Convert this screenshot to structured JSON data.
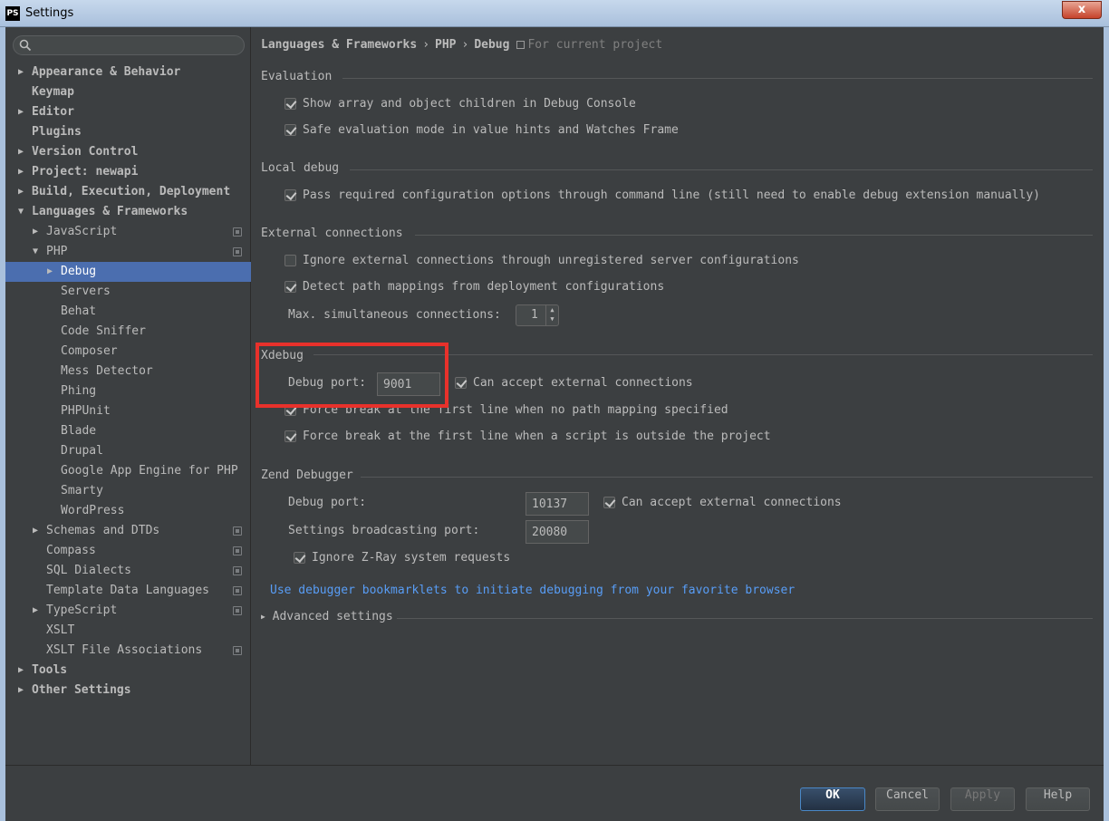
{
  "window": {
    "title": "Settings",
    "app_icon": "PS",
    "close_label": "x"
  },
  "search": {
    "placeholder": "",
    "value": ""
  },
  "sidebar": {
    "items": [
      {
        "label": "Appearance & Behavior",
        "level": 0,
        "arrow": "▶",
        "bold": true
      },
      {
        "label": "Keymap",
        "level": 0,
        "arrow": "",
        "bold": true
      },
      {
        "label": "Editor",
        "level": 0,
        "arrow": "▶",
        "bold": true
      },
      {
        "label": "Plugins",
        "level": 0,
        "arrow": "",
        "bold": true
      },
      {
        "label": "Version Control",
        "level": 0,
        "arrow": "▶",
        "bold": true
      },
      {
        "label": "Project: newapi",
        "level": 0,
        "arrow": "▶",
        "bold": true
      },
      {
        "label": "Build, Execution, Deployment",
        "level": 0,
        "arrow": "▶",
        "bold": true
      },
      {
        "label": "Languages & Frameworks",
        "level": 0,
        "arrow": "▼",
        "bold": true
      },
      {
        "label": "JavaScript",
        "level": 1,
        "arrow": "▶",
        "project": true
      },
      {
        "label": "PHP",
        "level": 1,
        "arrow": "▼",
        "project": true
      },
      {
        "label": "Debug",
        "level": 2,
        "arrow": "▶",
        "selected": true
      },
      {
        "label": "Servers",
        "level": 2,
        "arrow": ""
      },
      {
        "label": "Behat",
        "level": 2,
        "arrow": ""
      },
      {
        "label": "Code Sniffer",
        "level": 2,
        "arrow": ""
      },
      {
        "label": "Composer",
        "level": 2,
        "arrow": ""
      },
      {
        "label": "Mess Detector",
        "level": 2,
        "arrow": ""
      },
      {
        "label": "Phing",
        "level": 2,
        "arrow": ""
      },
      {
        "label": "PHPUnit",
        "level": 2,
        "arrow": ""
      },
      {
        "label": "Blade",
        "level": 2,
        "arrow": ""
      },
      {
        "label": "Drupal",
        "level": 2,
        "arrow": ""
      },
      {
        "label": "Google App Engine for PHP",
        "level": 2,
        "arrow": ""
      },
      {
        "label": "Smarty",
        "level": 2,
        "arrow": ""
      },
      {
        "label": "WordPress",
        "level": 2,
        "arrow": ""
      },
      {
        "label": "Schemas and DTDs",
        "level": 1,
        "arrow": "▶",
        "project": true
      },
      {
        "label": "Compass",
        "level": 1,
        "arrow": "",
        "project": true
      },
      {
        "label": "SQL Dialects",
        "level": 1,
        "arrow": "",
        "project": true
      },
      {
        "label": "Template Data Languages",
        "level": 1,
        "arrow": "",
        "project": true
      },
      {
        "label": "TypeScript",
        "level": 1,
        "arrow": "▶",
        "project": true
      },
      {
        "label": "XSLT",
        "level": 1,
        "arrow": ""
      },
      {
        "label": "XSLT File Associations",
        "level": 1,
        "arrow": "",
        "project": true
      },
      {
        "label": "Tools",
        "level": 0,
        "arrow": "▶",
        "bold": true
      },
      {
        "label": "Other Settings",
        "level": 0,
        "arrow": "▶",
        "bold": true
      }
    ]
  },
  "breadcrumb": {
    "part1": "Languages & Frameworks",
    "part2": "PHP",
    "part3": "Debug",
    "sep": "›",
    "scope": "For current project"
  },
  "evaluation": {
    "title": "Evaluation",
    "show_array": {
      "label": "Show array and object children in Debug Console",
      "checked": true
    },
    "safe_eval": {
      "label": "Safe evaluation mode in value hints and Watches Frame",
      "checked": true
    }
  },
  "local_debug": {
    "title": "Local debug",
    "pass_config": {
      "label": "Pass required configuration options through command line (still need to enable debug extension manually)",
      "checked": true
    }
  },
  "external": {
    "title": "External connections",
    "ignore_unregistered": {
      "label": "Ignore external connections through unregistered server configurations",
      "checked": false
    },
    "detect_mappings": {
      "label": "Detect path mappings from deployment configurations",
      "checked": true
    },
    "max_conn_label": "Max. simultaneous connections:",
    "max_conn_value": "1"
  },
  "xdebug": {
    "title": "Xdebug",
    "port_label": "Debug port:",
    "port_value": "9001",
    "accept_external": {
      "label": "Can accept external connections",
      "checked": true
    },
    "force_break_first": {
      "label": "Force break at the first line when no path mapping specified",
      "checked": true
    },
    "force_break_outside": {
      "label": "Force break at the first line when a script is outside the project",
      "checked": true
    }
  },
  "zend": {
    "title": "Zend Debugger",
    "port_label": "Debug port:",
    "port_value": "10137",
    "accept_external": {
      "label": "Can accept external connections",
      "checked": true
    },
    "broadcast_label": "Settings broadcasting port:",
    "broadcast_value": "20080",
    "ignore_zray": {
      "label": "Ignore Z-Ray system requests",
      "checked": true
    }
  },
  "bookmarklets_link": "Use debugger bookmarklets to initiate debugging from your favorite browser",
  "advanced": {
    "label": "Advanced settings",
    "arrow": "▶"
  },
  "footer": {
    "ok": "OK",
    "cancel": "Cancel",
    "apply": "Apply",
    "help": "Help"
  },
  "colors": {
    "background": "#3c3f41",
    "selection": "#4b6eaf",
    "link": "#589df6",
    "highlight": "#e8312b"
  }
}
